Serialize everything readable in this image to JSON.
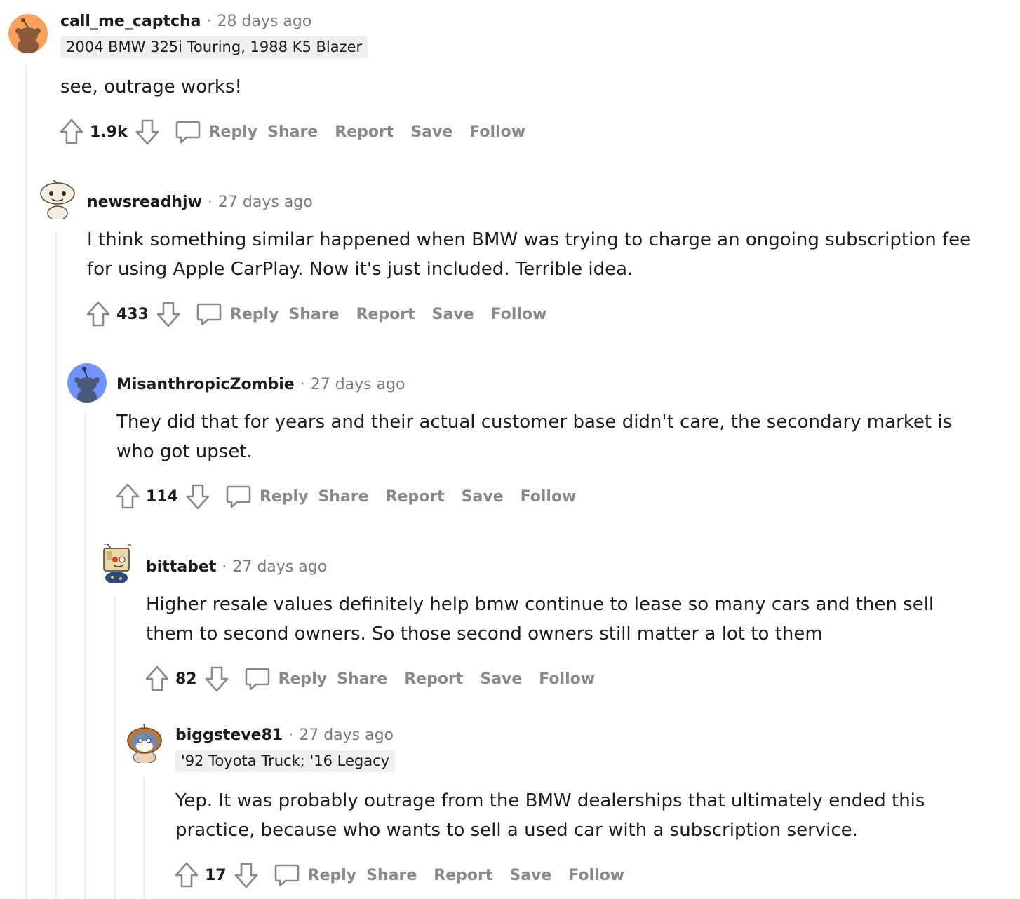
{
  "comments": [
    {
      "username": "call_me_captcha",
      "time": "28 days ago",
      "flair": "2004 BMW 325i Touring, 1988 K5 Blazer",
      "body": [
        "see, outrage works!"
      ],
      "score": "1.9k",
      "avatar": "snoo-orange"
    },
    {
      "username": "newsreadhjw",
      "time": "27 days ago",
      "flair": "",
      "body": [
        "I think something similar happened when BMW was trying to charge an ongoing subscription fee",
        "for using Apple CarPlay. Now it's just included. Terrible idea."
      ],
      "score": "433",
      "avatar": "snoo-cream"
    },
    {
      "username": "MisanthropicZombie",
      "time": "27 days ago",
      "flair": "",
      "body": [
        "They did that for years and their actual customer base didn't care, the secondary market is",
        "who got upset."
      ],
      "score": "114",
      "avatar": "snoo-blue"
    },
    {
      "username": "bittabet",
      "time": "27 days ago",
      "flair": "",
      "body": [
        "Higher resale values definitely help bmw continue to lease so many cars and then sell",
        "them to second owners. So those second owners still matter a lot to them"
      ],
      "score": "82",
      "avatar": "snoo-box"
    },
    {
      "username": "biggsteve81",
      "time": "27 days ago",
      "flair": "'92 Toyota Truck; '16 Legacy",
      "body": [
        "Yep. It was probably outrage from the BMW dealerships that ultimately ended this",
        "practice, because who wants to sell a used car with a subscription service."
      ],
      "score": "17",
      "avatar": "snoo-wizard"
    }
  ],
  "actions": {
    "reply": "Reply",
    "share": "Share",
    "report": "Report",
    "save": "Save",
    "follow": "Follow"
  },
  "separator": "·",
  "colors": {
    "muted_text": "#878a8c",
    "thread_line": "#edeff1",
    "flair_bg": "#edeff1",
    "avatar_orange": "#f7a15a",
    "avatar_blue": "#7193ff"
  }
}
